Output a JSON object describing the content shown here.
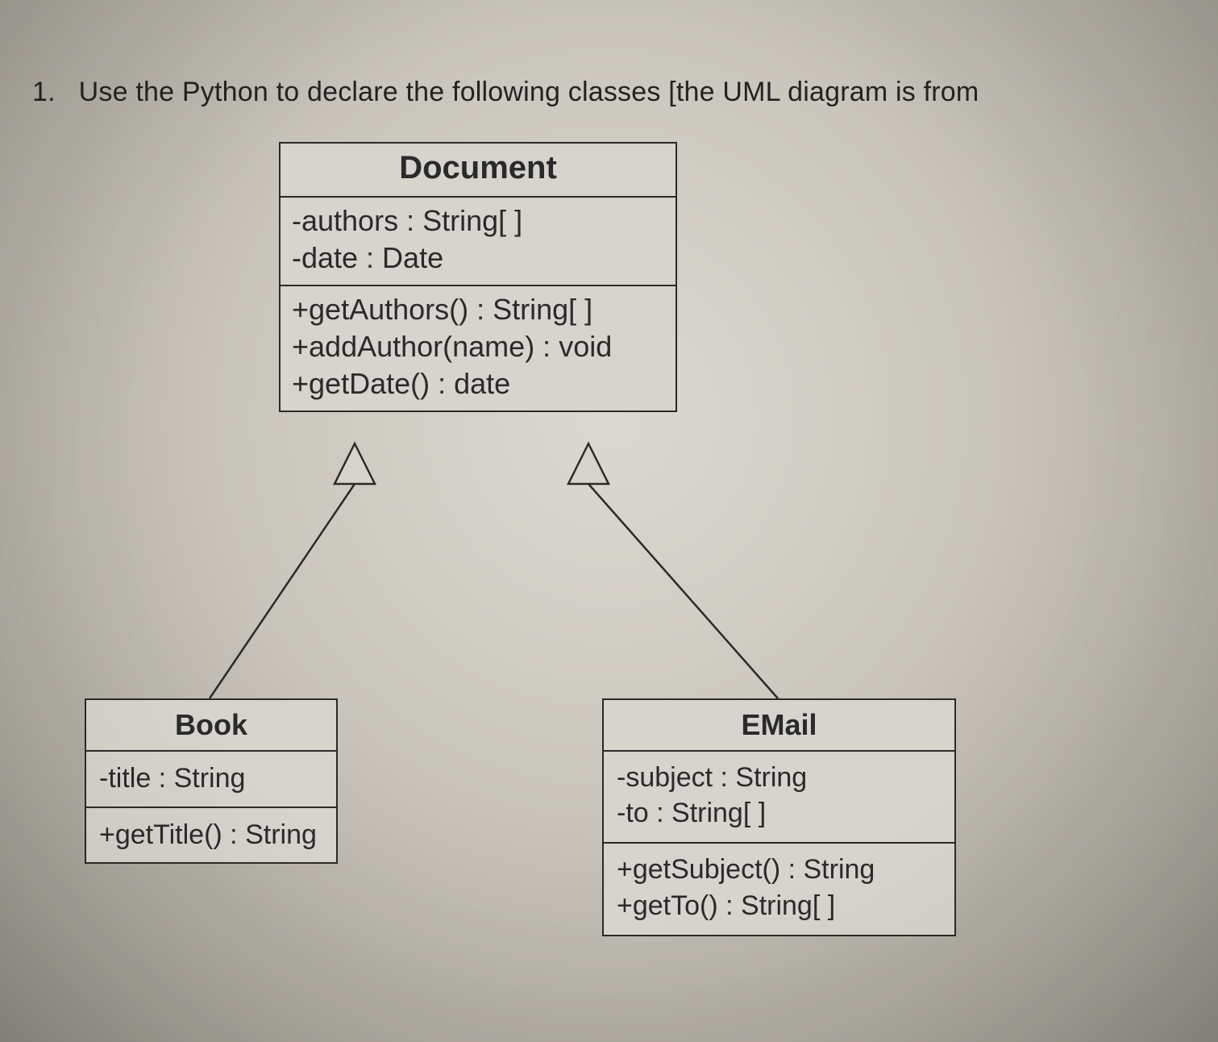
{
  "question": {
    "number": "1.",
    "text": "Use the Python to declare the following classes [the UML diagram is from"
  },
  "classes": {
    "document": {
      "name": "Document",
      "attributes": [
        "-authors : String[ ]",
        "-date : Date"
      ],
      "methods": [
        "+getAuthors() : String[ ]",
        "+addAuthor(name) : void",
        "+getDate() : date"
      ]
    },
    "book": {
      "name": "Book",
      "attributes": [
        "-title : String"
      ],
      "methods": [
        "+getTitle() : String"
      ]
    },
    "email": {
      "name": "EMail",
      "attributes": [
        "-subject : String",
        "-to : String[ ]"
      ],
      "methods": [
        "+getSubject() : String",
        "+getTo() : String[ ]"
      ]
    }
  },
  "relationships": [
    {
      "type": "generalization",
      "parent": "Document",
      "child": "Book"
    },
    {
      "type": "generalization",
      "parent": "Document",
      "child": "EMail"
    }
  ]
}
